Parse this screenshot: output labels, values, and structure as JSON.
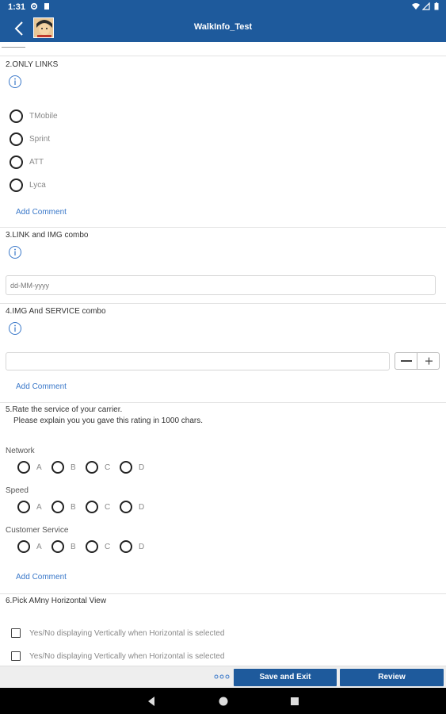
{
  "status_bar": {
    "time": "1:31"
  },
  "app_bar": {
    "title": "WalkInfo_Test"
  },
  "questions": {
    "q2": {
      "title": "2.ONLY LINKS",
      "options": [
        "TMobile",
        "Sprint",
        "ATT",
        "Lyca"
      ],
      "add_comment": "Add Comment"
    },
    "q3": {
      "title": "3.LINK and IMG combo",
      "date_placeholder": "dd-MM-yyyy"
    },
    "q4": {
      "title": "4.IMG And SERVICE combo",
      "add_comment": "Add Comment"
    },
    "q5": {
      "title_line1": "5.Rate the service of your carrier.",
      "title_line2": "Please explain you you gave this rating in 1000 chars.",
      "rows": [
        {
          "label": "Network",
          "options": [
            "A",
            "B",
            "C",
            "D"
          ]
        },
        {
          "label": "Speed",
          "options": [
            "A",
            "B",
            "C",
            "D"
          ]
        },
        {
          "label": "Customer Service",
          "options": [
            "A",
            "B",
            "C",
            "D"
          ]
        }
      ],
      "add_comment": "Add Comment"
    },
    "q6": {
      "title": "6.Pick AMny Horizontal View",
      "checks": [
        "Yes/No displaying Vertically when Horizontal is selected",
        "Yes/No displaying Vertically when Horizontal is selected"
      ]
    }
  },
  "bottom_bar": {
    "save_exit_label": "Save and Exit",
    "review_label": "Review"
  },
  "colors": {
    "primary": "#1e5a9c",
    "link": "#3a78c9"
  }
}
